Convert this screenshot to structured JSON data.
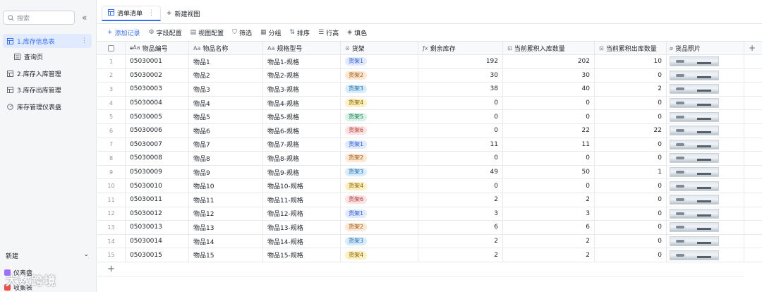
{
  "sidebar": {
    "search_placeholder": "搜索",
    "collapse_glyph": "«",
    "items": [
      {
        "label": "1.库存信息表",
        "active": true
      },
      {
        "label": "查询页",
        "sub": true
      },
      {
        "label": "2.库存入库管理"
      },
      {
        "label": "3.库存出库管理"
      },
      {
        "label": "库存管理仪表盘"
      }
    ],
    "new_label": "新建",
    "bottom_items": [
      "仪表盘",
      "收集表"
    ]
  },
  "watermark_logo": "大数跨境",
  "tabs": {
    "active_label": "清单清单",
    "new_view_label": "新建视图"
  },
  "toolbar": {
    "add_record": "添加记录",
    "field_config": "字段配置",
    "view_config": "视图配置",
    "filter": "筛选",
    "group": "分组",
    "sort": "排序",
    "row_height": "行高",
    "fill_color": "填色"
  },
  "columns": {
    "code": "物品编号",
    "name": "物品名称",
    "spec": "规格型号",
    "shelf": "货架",
    "stock": "剩余库存",
    "in_qty": "当前累积入库数量",
    "out_qty": "当前累积出库数量",
    "photo": "货品照片"
  },
  "shelf_colors": {
    "货架1": {
      "bg": "#e1eaff",
      "fg": "#245bdb"
    },
    "货架2": {
      "bg": "#fce8d4",
      "fg": "#a15c12"
    },
    "货架3": {
      "bg": "#d9ecfb",
      "fg": "#1a6fb3"
    },
    "货架4": {
      "bg": "#fff1c2",
      "fg": "#8a6200"
    },
    "货架5": {
      "bg": "#d7f2e6",
      "fg": "#1f7a52"
    },
    "货架6": {
      "bg": "#fde2e2",
      "fg": "#b83838"
    }
  },
  "rows": [
    {
      "idx": "1",
      "code": "05030001",
      "name": "物品1",
      "spec": "物品1-规格",
      "shelf": "货架1",
      "stock": "192",
      "in": "202",
      "out": "10"
    },
    {
      "idx": "2",
      "code": "05030002",
      "name": "物品2",
      "spec": "物品2-规格",
      "shelf": "货架2",
      "stock": "30",
      "in": "30",
      "out": "0"
    },
    {
      "idx": "3",
      "code": "05030003",
      "name": "物品3",
      "spec": "物品3-规格",
      "shelf": "货架3",
      "stock": "38",
      "in": "40",
      "out": "2"
    },
    {
      "idx": "4",
      "code": "05030004",
      "name": "物品4",
      "spec": "物品4-规格",
      "shelf": "货架4",
      "stock": "0",
      "in": "0",
      "out": "0"
    },
    {
      "idx": "5",
      "code": "05030005",
      "name": "物品5",
      "spec": "物品5-规格",
      "shelf": "货架5",
      "stock": "0",
      "in": "0",
      "out": "0"
    },
    {
      "idx": "6",
      "code": "05030006",
      "name": "物品6",
      "spec": "物品6-规格",
      "shelf": "货架6",
      "stock": "0",
      "in": "22",
      "out": "22"
    },
    {
      "idx": "7",
      "code": "05030007",
      "name": "物品7",
      "spec": "物品7-规格",
      "shelf": "货架1",
      "stock": "11",
      "in": "11",
      "out": "0"
    },
    {
      "idx": "8",
      "code": "05030008",
      "name": "物品8",
      "spec": "物品8-规格",
      "shelf": "货架2",
      "stock": "0",
      "in": "0",
      "out": "0"
    },
    {
      "idx": "9",
      "code": "05030009",
      "name": "物品9",
      "spec": "物品9-规格",
      "shelf": "货架3",
      "stock": "49",
      "in": "50",
      "out": "1"
    },
    {
      "idx": "10",
      "code": "05030010",
      "name": "物品10",
      "spec": "物品10-规格",
      "shelf": "货架4",
      "stock": "0",
      "in": "0",
      "out": "0"
    },
    {
      "idx": "11",
      "code": "05030011",
      "name": "物品11",
      "spec": "物品11-规格",
      "shelf": "货架6",
      "stock": "2",
      "in": "2",
      "out": "0"
    },
    {
      "idx": "12",
      "code": "05030012",
      "name": "物品12",
      "spec": "物品12-规格",
      "shelf": "货架1",
      "stock": "3",
      "in": "3",
      "out": "0"
    },
    {
      "idx": "13",
      "code": "05030013",
      "name": "物品13",
      "spec": "物品13-规格",
      "shelf": "货架2",
      "stock": "6",
      "in": "6",
      "out": "0"
    },
    {
      "idx": "14",
      "code": "05030014",
      "name": "物品14",
      "spec": "物品14-规格",
      "shelf": "货架3",
      "stock": "2",
      "in": "2",
      "out": "0"
    },
    {
      "idx": "15",
      "code": "05030015",
      "name": "物品15",
      "spec": "物品15-规格",
      "shelf": "货架4",
      "stock": "2",
      "in": "2",
      "out": "0"
    }
  ]
}
